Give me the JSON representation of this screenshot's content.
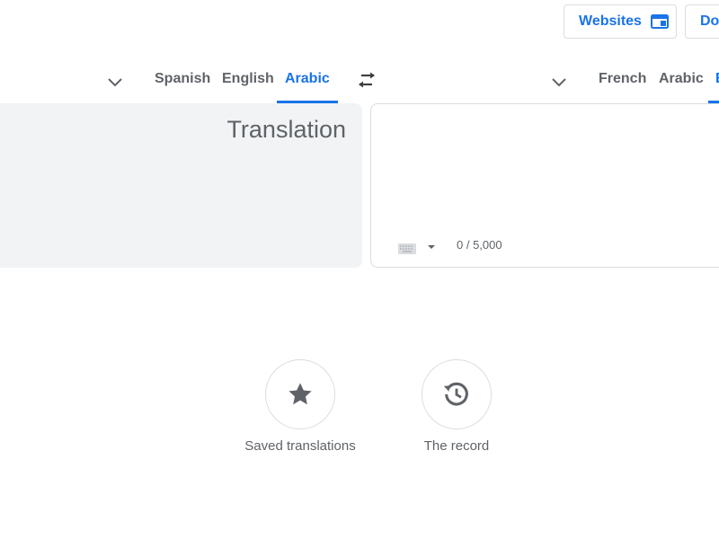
{
  "header": {
    "websites_label": "Websites",
    "docs_label": "Do"
  },
  "source_languages": {
    "tabs": [
      {
        "label": "Spanish"
      },
      {
        "label": "English"
      },
      {
        "label": "Arabic",
        "active": true
      }
    ]
  },
  "target_languages": {
    "tabs": [
      {
        "label": "French"
      },
      {
        "label": "Arabic"
      },
      {
        "label": "E"
      }
    ]
  },
  "source_panel": {
    "text": "Translation"
  },
  "target_panel": {
    "char_count": "0 / 5,000"
  },
  "actions": {
    "saved_label": "Saved translations",
    "record_label": "The record"
  },
  "colors": {
    "accent": "#1a73e8",
    "text_muted": "#5f6368",
    "panel_bg": "#f1f3f4",
    "border": "#dadce0"
  }
}
